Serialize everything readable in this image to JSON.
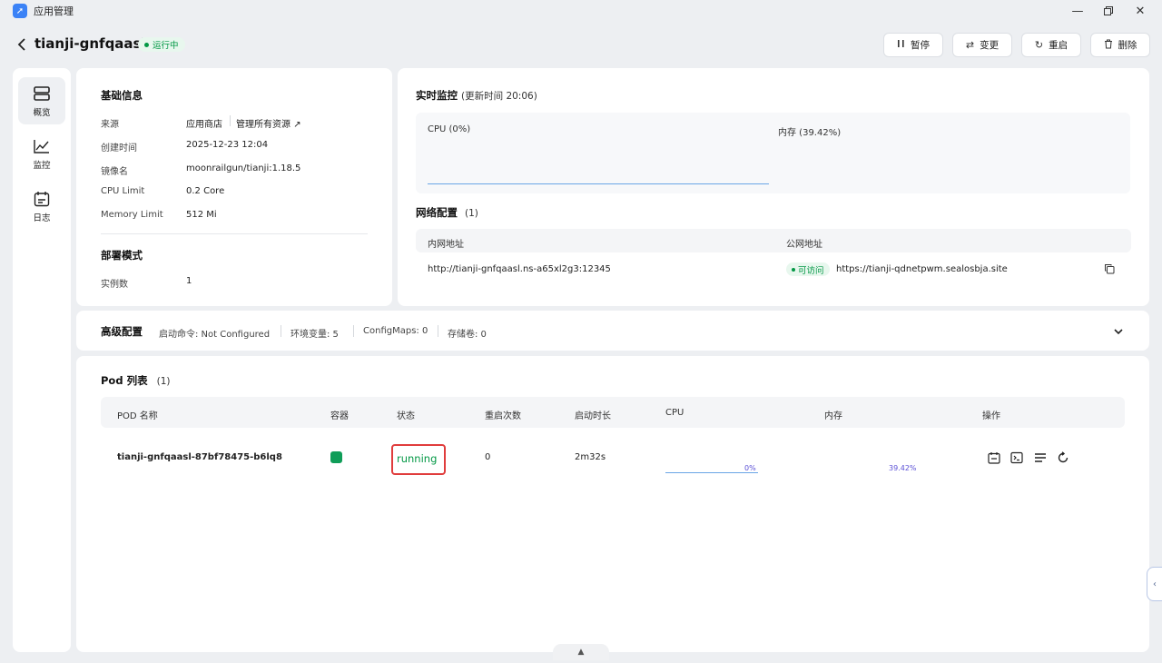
{
  "window": {
    "app_title": "应用管理"
  },
  "header": {
    "app_name": "tianji-gnfqaasl",
    "status": "运行中",
    "buttons": {
      "pause": "暂停",
      "change": "变更",
      "restart": "重启",
      "delete": "删除"
    }
  },
  "nav": {
    "overview": "概览",
    "monitor": "监控",
    "logs": "日志"
  },
  "basic": {
    "title": "基础信息",
    "source_label": "来源",
    "source_value": "应用商店",
    "manage_link": "管理所有资源",
    "created_label": "创建时间",
    "created_value": "2025-12-23 12:04",
    "image_label": "镜像名",
    "image_value": "moonrailgun/tianji:1.18.5",
    "cpu_label": "CPU Limit",
    "cpu_value": "0.2 Core",
    "mem_label": "Memory Limit",
    "mem_value": "512 Mi"
  },
  "deploy": {
    "title": "部署模式",
    "replicas_label": "实例数",
    "replicas_value": "1"
  },
  "monitor": {
    "title": "实时监控",
    "updated": "(更新时间  20:06)",
    "cpu_label": "CPU  (0%)",
    "mem_label": "内存  (39.42%)"
  },
  "network": {
    "title": "网络配置",
    "count": "(1)",
    "col_internal": "内网地址",
    "col_public": "公网地址",
    "internal_addr": "http://tianji-gnfqaasl.ns-a65xl2g3:12345",
    "public_status": "可访问",
    "public_addr": "https://tianji-qdnetpwm.sealosbja.site"
  },
  "advanced": {
    "title": "高级配置",
    "cmd": "启动命令: Not Configured",
    "env": "环境变量: 5",
    "configmaps": "ConfigMaps: 0",
    "storage": "存储卷: 0"
  },
  "pods": {
    "title": "Pod 列表",
    "count": "(1)",
    "columns": {
      "name": "POD 名称",
      "container": "容器",
      "status": "状态",
      "restarts": "重启次数",
      "uptime": "启动时长",
      "cpu": "CPU",
      "mem": "内存",
      "ops": "操作"
    },
    "rows": [
      {
        "name": "tianji-gnfqaasl-87bf78475-b6lq8",
        "status": "running",
        "restarts": "0",
        "uptime": "2m32s",
        "cpu_pct": "0%",
        "mem_pct": "39.42%"
      }
    ]
  },
  "colors": {
    "accent_green": "#039845",
    "highlight_red": "#e03c3c",
    "chart_line": "#6aa5e6"
  }
}
